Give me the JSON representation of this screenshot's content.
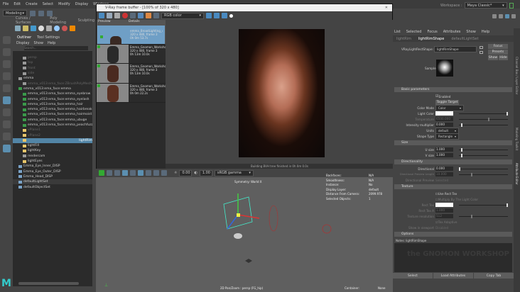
{
  "menubar": [
    "File",
    "Edit",
    "Create",
    "Select",
    "Modify",
    "Display",
    "Windows"
  ],
  "mode": "Modeling",
  "workspace": {
    "label": "Workspace :",
    "value": "Maya Classic*"
  },
  "shelf_tabs": [
    "Curves / Surfaces",
    "Poly Modeling",
    "Sculpting"
  ],
  "outliner": {
    "tabs": [
      "Outliner",
      "Tool Settings"
    ],
    "menu": [
      "Display",
      "Show",
      "Help"
    ],
    "search": "Search...",
    "items": [
      {
        "label": "persp",
        "icon": "camera",
        "dim": true,
        "indent": 1
      },
      {
        "label": "top",
        "icon": "camera",
        "dim": true,
        "indent": 1
      },
      {
        "label": "front",
        "icon": "camera",
        "dim": true,
        "indent": 1
      },
      {
        "label": "side",
        "icon": "camera",
        "dim": true,
        "indent": 1
      },
      {
        "label": "emma",
        "icon": "group",
        "indent": 0
      },
      {
        "label": "emma_v013:ema_face:ZBrushPolyMesh3D",
        "icon": "group",
        "dim": true,
        "indent": 1
      },
      {
        "label": "emma_v013:ema_face:emma",
        "icon": "mesh",
        "indent": 0
      },
      {
        "label": "emma_v013:ema_face:emma_eyebrow",
        "icon": "mesh",
        "indent": 1
      },
      {
        "label": "emma_v013:ema_face:emma_eyelash",
        "icon": "mesh",
        "indent": 1
      },
      {
        "label": "emma_v013:ema_face:emma_hair",
        "icon": "mesh",
        "indent": 1
      },
      {
        "label": "emma_v013:ema_face:emma_hairbreak",
        "icon": "mesh",
        "indent": 1
      },
      {
        "label": "emma_v013:ema_face:emma_hairmoist",
        "icon": "mesh",
        "indent": 1
      },
      {
        "label": "emma_v013:ema_face:emma_ubuge",
        "icon": "mesh",
        "indent": 1
      },
      {
        "label": "emma_v013:ema_face:emma_peachfuzz",
        "icon": "mesh",
        "indent": 1
      },
      {
        "label": "vPlane1",
        "icon": "light",
        "dim": true,
        "indent": 1
      },
      {
        "label": "vPlane2",
        "icon": "light",
        "dim": true,
        "indent": 1
      },
      {
        "label": "lightRim",
        "icon": "light",
        "selected": true,
        "indent": 1
      },
      {
        "label": "lightFill",
        "icon": "light",
        "indent": 1
      },
      {
        "label": "lightKey",
        "icon": "light",
        "indent": 1
      },
      {
        "label": "rendercam",
        "icon": "camera",
        "indent": 1
      },
      {
        "label": "lightEyes",
        "icon": "light",
        "indent": 1
      },
      {
        "label": "Emma_Eye_Inner_DISP",
        "icon": "disp",
        "indent": 0
      },
      {
        "label": "Emma_Eye_Outer_DISP",
        "icon": "disp",
        "indent": 0
      },
      {
        "label": "Emma_Head_DISP",
        "icon": "disp",
        "indent": 0
      },
      {
        "label": "defaultLightSet",
        "icon": "set",
        "highlight": true,
        "indent": 0
      },
      {
        "label": "defaultObjectSet",
        "icon": "set",
        "indent": 0
      }
    ]
  },
  "vfb": {
    "title": "V-Ray frame buffer - [100% of 320 x 480]",
    "channel": "RGB color",
    "history_headers": [
      "Preview",
      "Details"
    ],
    "history": [
      {
        "name": "emma_BroadLighting_v03",
        "res": "320 x 480, frame 3",
        "time": "0h 0m 53.7s",
        "selected": true
      },
      {
        "name": "Emma_Gnomon_Workshop",
        "res": "320 x 480, frame 3",
        "time": "0h 13m 10.0s"
      },
      {
        "name": "Emma_Gnomon_Workshop",
        "res": "320 x 480, frame 3",
        "time": "0h 13m 10.0s"
      },
      {
        "name": "Emma_Gnomon_Workshop",
        "res": "320 x 480, frame 3",
        "time": "0h 0m 22.2s"
      }
    ],
    "status": "Building BVH tree finished in 0h 0m 0.0s"
  },
  "viewport": {
    "exposure": "0.00",
    "gamma": "1.00",
    "colorspace": "sRGB gamma",
    "symmetry": "Symmetry: World X",
    "hud": [
      [
        "Backfaces:",
        "N/A"
      ],
      [
        "Smoothness:",
        "N/A"
      ],
      [
        "Instance:",
        "No"
      ],
      [
        "Display Layer:",
        "default"
      ],
      [
        "Distance From Camera:",
        "2099.978"
      ],
      [
        "Selected Objects:",
        "1"
      ]
    ],
    "camera_label": "2D Pan/Zoom : persp (FG_hip)",
    "container_label": "Container:",
    "container_value": "None"
  },
  "attr_editor": {
    "menu": [
      "List",
      "Selected",
      "Focus",
      "Attributes",
      "Show",
      "Help"
    ],
    "tabs": [
      "lightRim",
      "lightRimShape",
      "defaultLightSet"
    ],
    "node_label": "VRayLightRectShape:",
    "node_value": "lightRimShape",
    "buttons": {
      "focus": "Focus",
      "presets": "Presets",
      "show": "Show",
      "hide": "Hide"
    },
    "sample_label": "Sample",
    "sections": {
      "basic": "Basic parameters",
      "size": "Size",
      "dir": "Directionality",
      "tex": "Texture",
      "options": "Options"
    },
    "enabled": "Enabled",
    "toggle_target": "Toggle Target",
    "color_mode": {
      "label": "Color Mode",
      "value": "Color"
    },
    "light_color": "Light Color",
    "temperature": {
      "label": "Temperature",
      "value": "6500.000"
    },
    "intensity": {
      "label": "Intensity multiplier",
      "value": "0.000"
    },
    "units": {
      "label": "Units",
      "value": "default"
    },
    "shape": {
      "label": "Shape Type",
      "value": "Rectangle"
    },
    "usize": {
      "label": "U size",
      "value": "1.000"
    },
    "vsize": {
      "label": "V size",
      "value": "1.000"
    },
    "directional": {
      "label": "Directional",
      "value": "0.000"
    },
    "dir_len": {
      "label": "Directional Preview Length",
      "value": "10.000"
    },
    "dir_prev": {
      "label": "Directional Preview",
      "value": "Selected"
    },
    "use_rect_tex": "Use Rect Tex",
    "multiply": "Multiply By The Light Color",
    "rect_tex": "Rect Tex",
    "rect_tex_a": {
      "label": "Rect Tex A",
      "value": "1.000"
    },
    "tex_res": {
      "label": "Texture resolution",
      "value": "512"
    },
    "tex_adaptive": "Tex Adaptive",
    "show_vp": {
      "label": "Show in viewport",
      "value": "Disabled"
    },
    "notes": "Notes: lightRimShape",
    "footer": [
      "Select",
      "Load Attributes",
      "Copy Tab"
    ],
    "side_tabs": [
      "Channel Box / Layer Editor",
      "Modeling Toolkit",
      "Attribute Editor"
    ]
  },
  "watermark": "the GNOMON WORKSHOP",
  "logo": "M"
}
